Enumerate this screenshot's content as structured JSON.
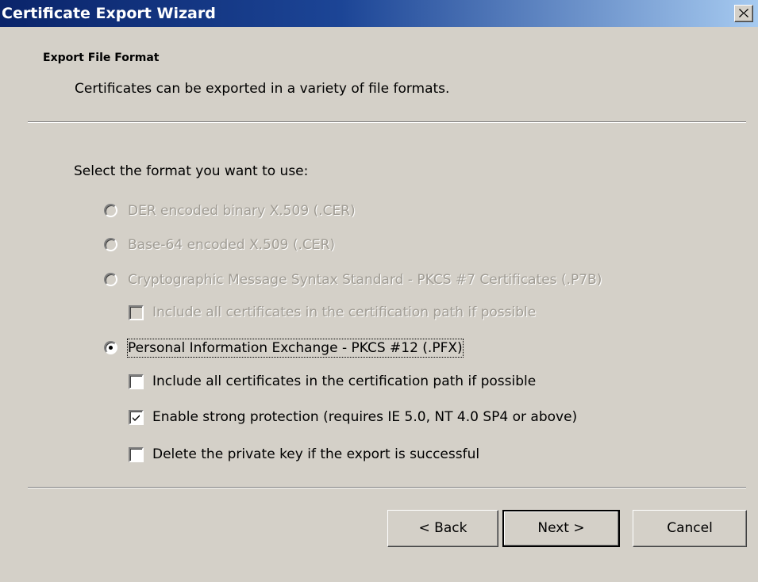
{
  "window": {
    "title": "Certificate Export Wizard",
    "close_icon": "close-icon"
  },
  "header": {
    "title": "Export File Format",
    "subtitle": "Certificates can be exported in a variety of file formats."
  },
  "form": {
    "prompt": "Select the format you want to use:",
    "options": [
      {
        "label": "DER encoded binary X.509 (.CER)",
        "type": "radio",
        "enabled": false,
        "selected": false
      },
      {
        "label": "Base-64 encoded X.509 (.CER)",
        "type": "radio",
        "enabled": false,
        "selected": false
      },
      {
        "label": "Cryptographic Message Syntax Standard - PKCS #7 Certificates (.P7B)",
        "type": "radio",
        "enabled": false,
        "selected": false
      },
      {
        "label": "Include all certificates in the certification path if possible",
        "type": "checkbox",
        "enabled": false,
        "checked": false
      },
      {
        "label": "Personal Information Exchange - PKCS #12 (.PFX)",
        "type": "radio",
        "enabled": true,
        "selected": true
      },
      {
        "label": "Include all certificates in the certification path if possible",
        "type": "checkbox",
        "enabled": true,
        "checked": false
      },
      {
        "label": "Enable strong protection (requires IE 5.0, NT 4.0 SP4 or above)",
        "type": "checkbox",
        "enabled": true,
        "checked": true
      },
      {
        "label": "Delete the private key if the export is successful",
        "type": "checkbox",
        "enabled": true,
        "checked": false
      }
    ]
  },
  "buttons": {
    "back": "< Back",
    "next": "Next >",
    "cancel": "Cancel"
  },
  "colors": {
    "titlebar_start": "#0a246a",
    "titlebar_end": "#a6caf0",
    "dialog_bg": "#d4d0c8",
    "disabled_text": "#a09c94"
  }
}
